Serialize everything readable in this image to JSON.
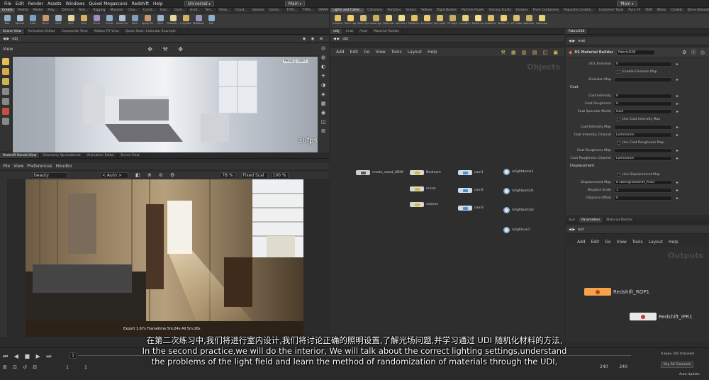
{
  "menubar": {
    "items": [
      "File",
      "Edit",
      "Render",
      "Assets",
      "Windows",
      "Quixel Megascans",
      "Redshift",
      "Help"
    ],
    "desktop": "Universal",
    "scene": "Main",
    "right_scene": "Main"
  },
  "shelf_left": {
    "tabs": [
      "Create",
      "Modify",
      "Model",
      "Poly...",
      "Deform",
      "Text...",
      "Rigging",
      "Muscles",
      "Char...",
      "Const...",
      "Hair...",
      "Guid...",
      "Guid...",
      "Terr...",
      "Simp...",
      "Cloud...",
      "Volume",
      "Game...",
      "TOPs...",
      "TOPs...",
      "SMAN"
    ],
    "tools": [
      "Box",
      "Sphere",
      "Tube",
      "Torus",
      "Grid",
      "Null",
      "Line",
      "Circle",
      "Curve",
      "Draw Curve",
      "Path",
      "Spray Paint",
      "Font",
      "Platonic Solids",
      "L-System",
      "Metaball",
      "File"
    ]
  },
  "shelf_right": {
    "tabs": [
      "Lights and Came...",
      "Collisions",
      "Particles",
      "Grains",
      "Vellum",
      "Rigid Bodies",
      "Particle Fluids",
      "Viscous Fluids",
      "Oceans",
      "Fluid Containers",
      "Populate Contain...",
      "Container Tools",
      "Pyro FX",
      "FEM",
      "Wires",
      "Crowds",
      "Drive Simulation",
      "Scripts",
      "Redshift"
    ],
    "tools": [
      "Camera",
      "Point Light",
      "Spot Light",
      "Area Light",
      "Geometry Light",
      "Volume Light",
      "Distant Light",
      "Environment Light",
      "Sky Light",
      "GI Light",
      "Caustic Light",
      "Portal Light",
      "Ambient Light",
      "Stereo Camera",
      "VR Camera",
      "Switcher",
      "Gamepad Camera"
    ]
  },
  "scene_view": {
    "tabs": [
      "Scene View",
      "Animation Editor",
      "Composite View",
      "Motion FX View",
      "Quick Start: Calendar Example"
    ],
    "path": "obj",
    "title": "View",
    "cam_labels": [
      "Persp",
      "cam1"
    ],
    "fps": "38fps"
  },
  "rs_panel": {
    "tabs": [
      "Redshift RenderView",
      "Geometry Spreadsheet",
      "Animation Editor",
      "Scene View"
    ],
    "menu": [
      "File",
      "View",
      "Preferences",
      "Houdini"
    ],
    "aov": "beauty",
    "auto": "< Auto >",
    "zoom": "78 %",
    "scale": "Fixed Scal",
    "percent": "100 %",
    "status": "Export 1.67s  Frametime 5m:24s  All 5m:26s"
  },
  "network_obj": {
    "tabs": [
      "/obj",
      "/mat",
      "/mat",
      "Material Palette"
    ],
    "path": "obj",
    "menu": [
      "Add",
      "Edit",
      "Go",
      "View",
      "Tools",
      "Layout",
      "Help"
    ],
    "watermark": "Objects",
    "nodes": [
      {
        "label": "create_wood_UDIM"
      },
      {
        "label": "Bedroom"
      },
      {
        "label": "mirror"
      },
      {
        "label": "volume"
      },
      {
        "label": "cam1"
      },
      {
        "label": "cam2"
      },
      {
        "label": "cam3"
      }
    ],
    "lights": [
      "rslightdome1",
      "rslightportal1",
      "rslightportal2",
      "rslightsun1"
    ]
  },
  "params": {
    "tabs": [
      "Fabric028"
    ],
    "path": "mat",
    "node_type": "RS Material Builder",
    "node_name": "Fabric028",
    "rows": [
      {
        "label": "OGL Emission",
        "value": "0"
      },
      {
        "label": "",
        "check": "Enable Emission Map"
      },
      {
        "label": "Emission Map",
        "value": ""
      },
      {
        "section": "Coat"
      },
      {
        "label": "Coat Intensity",
        "value": "0"
      },
      {
        "label": "Coat Roughness",
        "value": "0"
      },
      {
        "label": "Coat Specular Model",
        "value": "GGX"
      },
      {
        "label": "",
        "check": "Use Coat Intensity Map"
      },
      {
        "label": "Coat Intensity Map",
        "value": ""
      },
      {
        "label": "Coat Intensity Channel",
        "value": "Luminance"
      },
      {
        "label": "",
        "check": "Use Coat Roughness Map"
      },
      {
        "label": "Coat Roughness Map",
        "value": ""
      },
      {
        "label": "Coat Roughness Channel",
        "value": "Luminance"
      },
      {
        "section": "Displacement"
      },
      {
        "label": "",
        "check": "Use Displacement Map"
      },
      {
        "label": "Displacement Map",
        "value": "H:/Bereg/Redshift_Pract"
      },
      {
        "label": "Displace Scale",
        "value": "1"
      },
      {
        "label": "Displace Offset",
        "value": "0"
      }
    ]
  },
  "network_out": {
    "tabs": [
      "/out",
      "Parameters",
      "Material Palette"
    ],
    "path": "out",
    "menu": [
      "Add",
      "Edit",
      "Go",
      "View",
      "Tools",
      "Layout",
      "Help"
    ],
    "watermark": "Outputs",
    "nodes": [
      "Redshift_ROP1",
      "Redshift_IPR1"
    ]
  },
  "timeline": {
    "frame": "1",
    "start": "1",
    "end": "1",
    "range_end": "240",
    "range_end2": "240",
    "keys": "0 keys, 0/0 channels",
    "key_all": "Key All Channels",
    "auto_update": "Auto Update"
  },
  "subtitles": {
    "zh": "在第二次练习中,我们将进行室内设计,我们将讨论正确的照明设置,了解光场问题,并学习通过 UDI 随机化材料的方法,",
    "en1": "In the second practice,we will do the interior, We will talk about the correct lighting settings,understand",
    "en2": "the problems of the light field and learn the method of randomization of materials through the UDI,"
  },
  "colors": {
    "accent": "#f4a34a",
    "light_ring": "#8ab4d8",
    "node_blue": "#4a8fd0",
    "node_yellow": "#d4b830"
  }
}
